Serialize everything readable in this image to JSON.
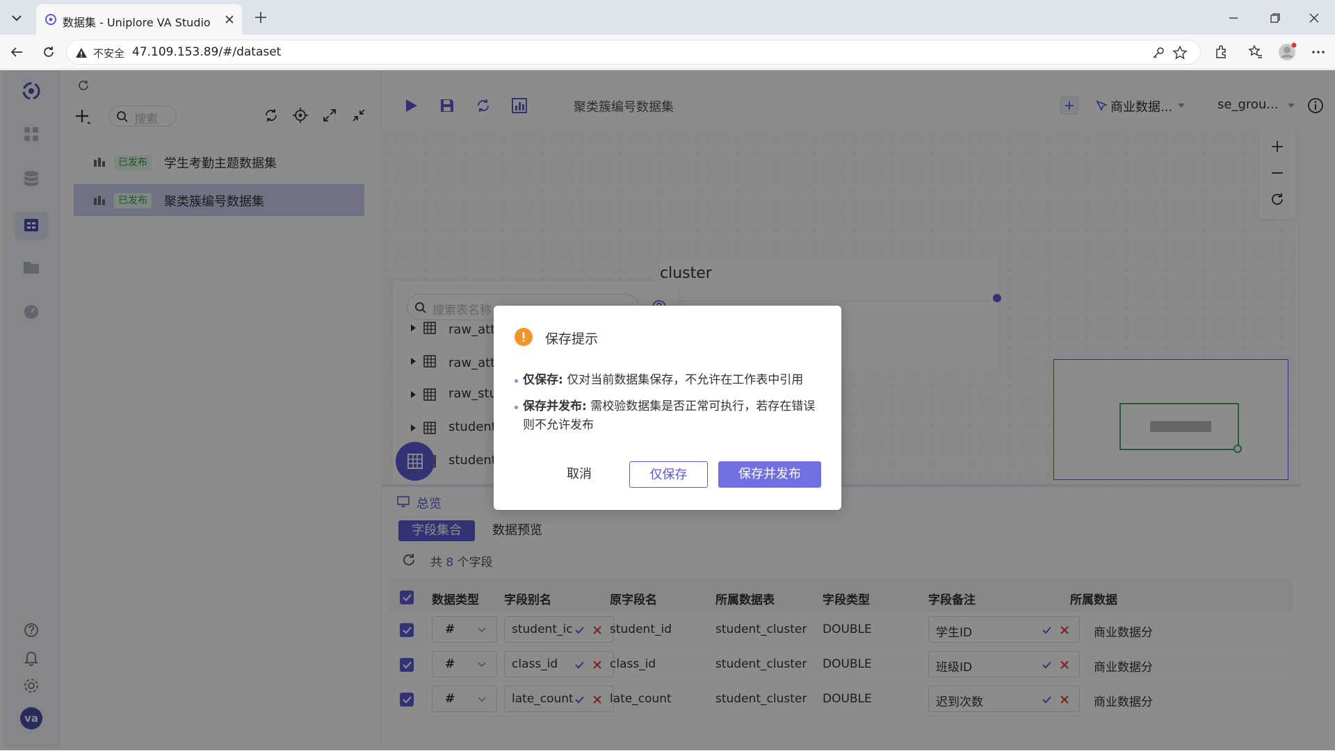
{
  "browser": {
    "tab_title": "数据集 - Uniplore VA Studio",
    "url_insecure_label": "不安全",
    "url": "47.109.153.89/#/dataset"
  },
  "sidebar": {
    "search_placeholder": "搜索",
    "items": [
      {
        "status": "已发布",
        "name": "学生考勤主题数据集"
      },
      {
        "status": "已发布",
        "name": "聚类簇编号数据集"
      }
    ]
  },
  "toolbar": {
    "dataset_name": "聚类簇编号数据集",
    "datasource": "商业数据...",
    "schema": "se_grou..."
  },
  "table_panel": {
    "search_placeholder": "搜索表名称",
    "tables": [
      "raw_attendance 原始_学生考勤表",
      "raw_attendance_type 原始_考勤类型",
      "raw_stud",
      "student_",
      "student_"
    ]
  },
  "canvas": {
    "node_label": "cluster"
  },
  "bottom": {
    "overview_label": "总览",
    "tab_fields": "字段集合",
    "tab_preview": "数据预览",
    "count_prefix": "共",
    "count_value": "8",
    "count_suffix": "个字段",
    "columns": [
      "数据类型",
      "字段别名",
      "原字段名",
      "所属数据表",
      "字段类型",
      "字段备注",
      "所属数据"
    ],
    "rows": [
      {
        "type": "#",
        "alias": "student_ic",
        "orig": "student_id",
        "table": "student_cluster",
        "ftype": "DOUBLE",
        "remark": "学生ID",
        "source": "商业数据分"
      },
      {
        "type": "#",
        "alias": "class_id",
        "orig": "class_id",
        "table": "student_cluster",
        "ftype": "DOUBLE",
        "remark": "班级ID",
        "source": "商业数据分"
      },
      {
        "type": "#",
        "alias": "late_count",
        "orig": "late_count",
        "table": "student_cluster",
        "ftype": "DOUBLE",
        "remark": "迟到次数",
        "source": "商业数据分"
      }
    ]
  },
  "dialog": {
    "title": "保存提示",
    "line1_bold": "仅保存:",
    "line1_text": "仅对当前数据集保存，不允许在工作表中引用",
    "line2_bold": "保存并发布:",
    "line2_text": "需校验数据集是否正常可执行，若存在错误则不允许发布",
    "cancel": "取消",
    "save_only": "仅保存",
    "save_publish": "保存并发布"
  },
  "user": {
    "avatar_initials": "va"
  },
  "colors": {
    "accent": "#5b5bd6",
    "badge_bg": "#e6f6ea",
    "badge_text": "#3a9c54",
    "warning": "#f0952a"
  }
}
